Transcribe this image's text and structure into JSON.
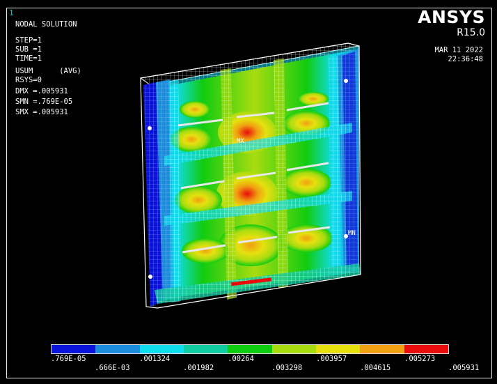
{
  "window": {
    "number": "1"
  },
  "brand": {
    "name": "ANSYS",
    "version": "R15.0"
  },
  "timestamp": {
    "date": "MAR 11 2022",
    "time": "22:36:48"
  },
  "solution_info": [
    "NODAL SOLUTION",
    "",
    "STEP=1",
    "SUB =1",
    "TIME=1",
    "USUM      (AVG)",
    "RSYS=0",
    "DMX =.005931",
    "SMN =.769E-05",
    "SMX =.005931"
  ],
  "model_labels": {
    "min": "MN",
    "max": "MX"
  },
  "legend": {
    "colors": [
      "#0a14d8",
      "#1e8cdc",
      "#10dcf0",
      "#10cca0",
      "#10cc10",
      "#a8dc10",
      "#e6e010",
      "#f0a010",
      "#e80c0c"
    ],
    "labels_row1": [
      ".769E-05",
      ".001324",
      ".00264",
      ".003957",
      ".005273"
    ],
    "labels_row2": [
      ".666E-03",
      ".001982",
      ".003298",
      ".004615",
      ".005931"
    ]
  }
}
